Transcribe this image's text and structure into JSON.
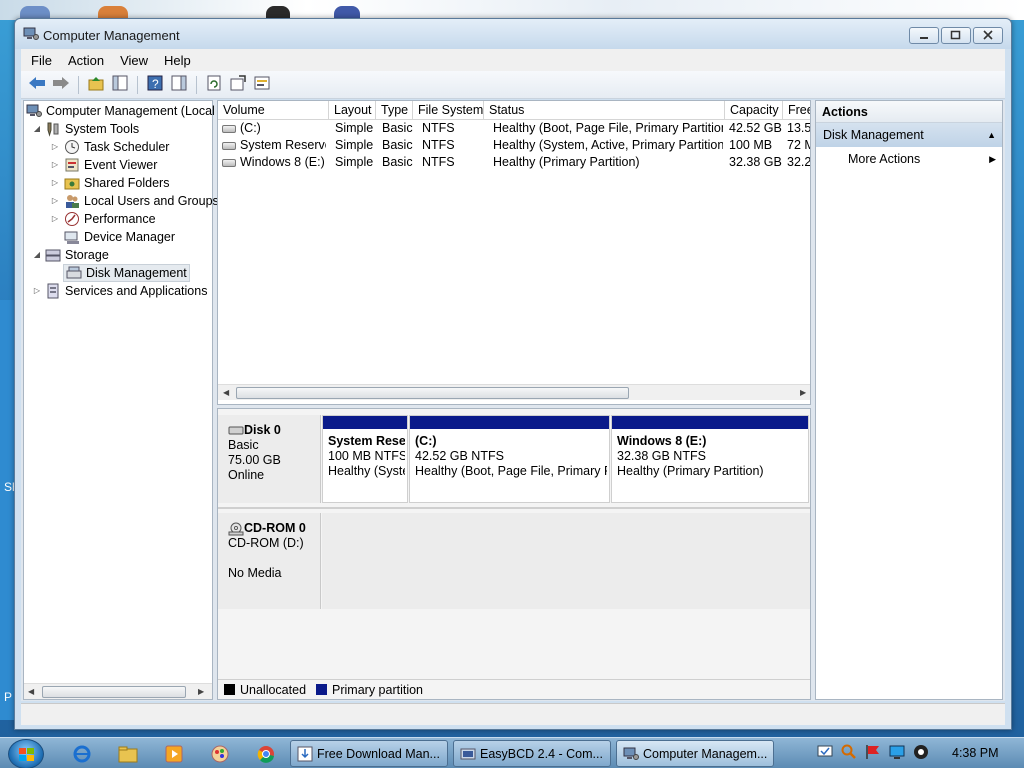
{
  "window": {
    "title": "Computer Management",
    "caption_buttons": [
      "minimize-icon",
      "restore-icon",
      "close-icon"
    ]
  },
  "menu": [
    "File",
    "Action",
    "View",
    "Help"
  ],
  "toolbar_icons": [
    "back-arrow-icon",
    "forward-arrow-icon",
    "up-folder-icon",
    "show-hide-tree-icon",
    "help-icon",
    "show-hide-action-pane-icon",
    "refresh-icon",
    "export-list-icon",
    "properties-icon"
  ],
  "tree": {
    "items": [
      {
        "label": "Computer Management (Local",
        "icon": "computer-management-icon",
        "expander": "expanded"
      },
      {
        "label": "System Tools",
        "icon": "system-tools-icon",
        "expander": "expanded"
      },
      {
        "label": "Task Scheduler",
        "icon": "clock-icon",
        "expander": "collapsed"
      },
      {
        "label": "Event Viewer",
        "icon": "event-viewer-icon",
        "expander": "collapsed"
      },
      {
        "label": "Shared Folders",
        "icon": "shared-folders-icon",
        "expander": "collapsed"
      },
      {
        "label": "Local Users and Groups",
        "icon": "users-icon",
        "expander": "collapsed"
      },
      {
        "label": "Performance",
        "icon": "performance-icon",
        "expander": "collapsed"
      },
      {
        "label": "Device Manager",
        "icon": "device-manager-icon",
        "expander": "none"
      },
      {
        "label": "Storage",
        "icon": "storage-icon",
        "expander": "expanded"
      },
      {
        "label": "Disk Management",
        "icon": "disk-management-icon",
        "expander": "none",
        "selected": true
      },
      {
        "label": "Services and Applications",
        "icon": "services-icon",
        "expander": "collapsed"
      }
    ]
  },
  "volume_list": {
    "columns": [
      "Volume",
      "Layout",
      "Type",
      "File System",
      "Status",
      "Capacity",
      "Free"
    ],
    "rows": [
      {
        "volume": "(C:)",
        "layout": "Simple",
        "type": "Basic",
        "fs": "NTFS",
        "status": "Healthy (Boot, Page File, Primary Partition)",
        "capacity": "42.52 GB",
        "free": "13.5"
      },
      {
        "volume": "System Reserved",
        "layout": "Simple",
        "type": "Basic",
        "fs": "NTFS",
        "status": "Healthy (System, Active, Primary Partition)",
        "capacity": "100 MB",
        "free": "72 M"
      },
      {
        "volume": "Windows 8 (E:)",
        "layout": "Simple",
        "type": "Basic",
        "fs": "NTFS",
        "status": "Healthy (Primary Partition)",
        "capacity": "32.38 GB",
        "free": "32.2"
      }
    ]
  },
  "disks": [
    {
      "name": "Disk 0",
      "kind": "Basic",
      "size": "75.00 GB",
      "state": "Online",
      "icon": "hard-disk-icon",
      "partitions": [
        {
          "title": "System Rese",
          "detail": "100 MB NTFS",
          "status": "Healthy (Syste"
        },
        {
          "title": "(C:)",
          "detail": "42.52 GB NTFS",
          "status": "Healthy (Boot, Page File, Primary Pa"
        },
        {
          "title": "Windows 8  (E:)",
          "detail": "32.38 GB NTFS",
          "status": "Healthy (Primary Partition)"
        }
      ]
    },
    {
      "name": "CD-ROM 0",
      "kind": "CD-ROM (D:)",
      "state": "No Media",
      "icon": "cdrom-icon"
    }
  ],
  "legend": {
    "unallocated": "Unallocated",
    "primary": "Primary partition"
  },
  "colors": {
    "primary_partition": "#0a1a8a",
    "unallocated": "#000000",
    "selection": "#c5d8ec"
  },
  "actions": {
    "header": "Actions",
    "section": "Disk Management",
    "items": [
      "More Actions"
    ]
  },
  "taskbar": {
    "pinned": [
      "internet-explorer-icon",
      "file-explorer-icon",
      "media-player-icon",
      "paint-icon",
      "chrome-icon"
    ],
    "tasks": [
      {
        "label": "Free Download Man...",
        "icon": "download-manager-icon"
      },
      {
        "label": "EasyBCD 2.4 - Com...",
        "icon": "easybcd-icon"
      },
      {
        "label": "Computer Managem...",
        "icon": "computer-management-icon",
        "active": true
      }
    ],
    "tray": [
      "action-center-icon",
      "search-icon",
      "flag-icon",
      "network-icon",
      "volume-icon"
    ],
    "clock": "4:38 PM"
  }
}
